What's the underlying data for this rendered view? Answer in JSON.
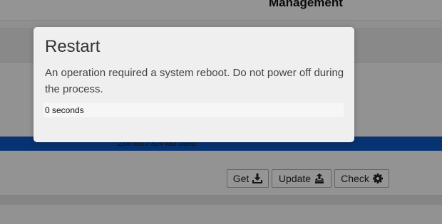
{
  "header": {
    "title": "Management"
  },
  "storage": {
    "usage_text": "238 Mb / 324 Mb used",
    "fill_fraction": 1.0,
    "bar_color": "#0d55c0"
  },
  "actions": {
    "get_label": "Get",
    "get_icon": "download-icon",
    "update_label": "Update",
    "update_icon": "upload-install-icon",
    "check_label": "Check",
    "check_icon": "gear-icon"
  },
  "modal": {
    "title": "Restart",
    "message": "An operation required a system reboot. Do not power off during the process.",
    "countdown_text": "0 seconds"
  }
}
